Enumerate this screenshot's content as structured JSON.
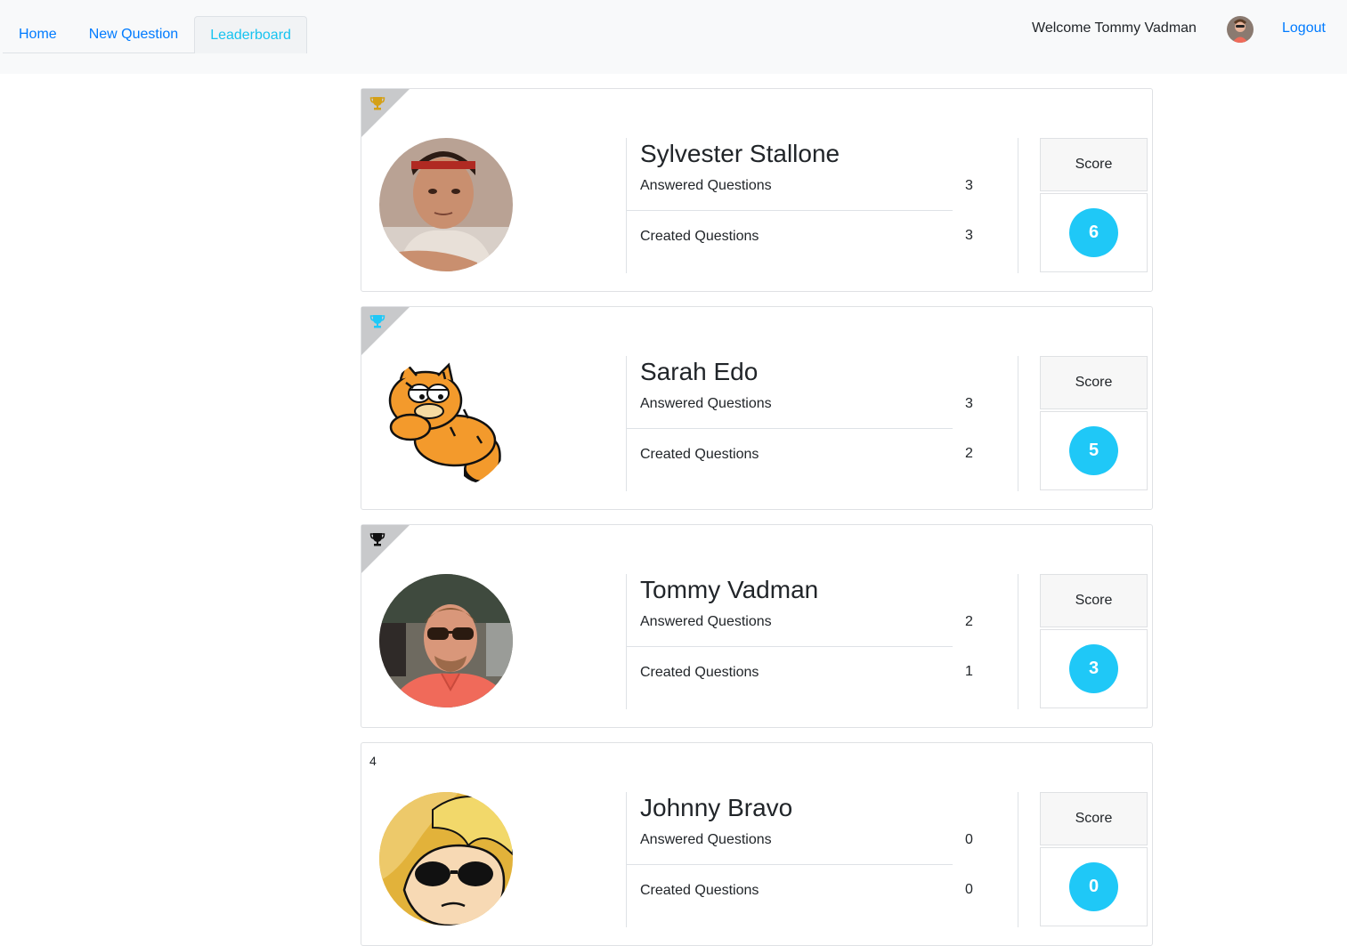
{
  "nav": {
    "tabs": [
      {
        "label": "Home"
      },
      {
        "label": "New Question"
      },
      {
        "label": "Leaderboard"
      }
    ],
    "welcome": "Welcome Tommy Vadman",
    "logout": "Logout"
  },
  "leaderboard": [
    {
      "rank": "1",
      "trophy_color": "#d4a017",
      "name": "Sylvester Stallone",
      "answered_label": "Answered Questions",
      "answered": "3",
      "created_label": "Created Questions",
      "created": "3",
      "score_label": "Score",
      "score": "6"
    },
    {
      "rank": "2",
      "trophy_color": "#1fc8f7",
      "name": "Sarah Edo",
      "answered_label": "Answered Questions",
      "answered": "3",
      "created_label": "Created Questions",
      "created": "2",
      "score_label": "Score",
      "score": "5"
    },
    {
      "rank": "3",
      "trophy_color": "#111111",
      "name": "Tommy Vadman",
      "answered_label": "Answered Questions",
      "answered": "2",
      "created_label": "Created Questions",
      "created": "1",
      "score_label": "Score",
      "score": "3"
    },
    {
      "rank": "4",
      "name": "Johnny Bravo",
      "answered_label": "Answered Questions",
      "answered": "0",
      "created_label": "Created Questions",
      "created": "0",
      "score_label": "Score",
      "score": "0"
    }
  ],
  "colors": {
    "link": "#007bff",
    "active_tab": "#17c3f0",
    "score_badge": "#1fc8f7"
  }
}
